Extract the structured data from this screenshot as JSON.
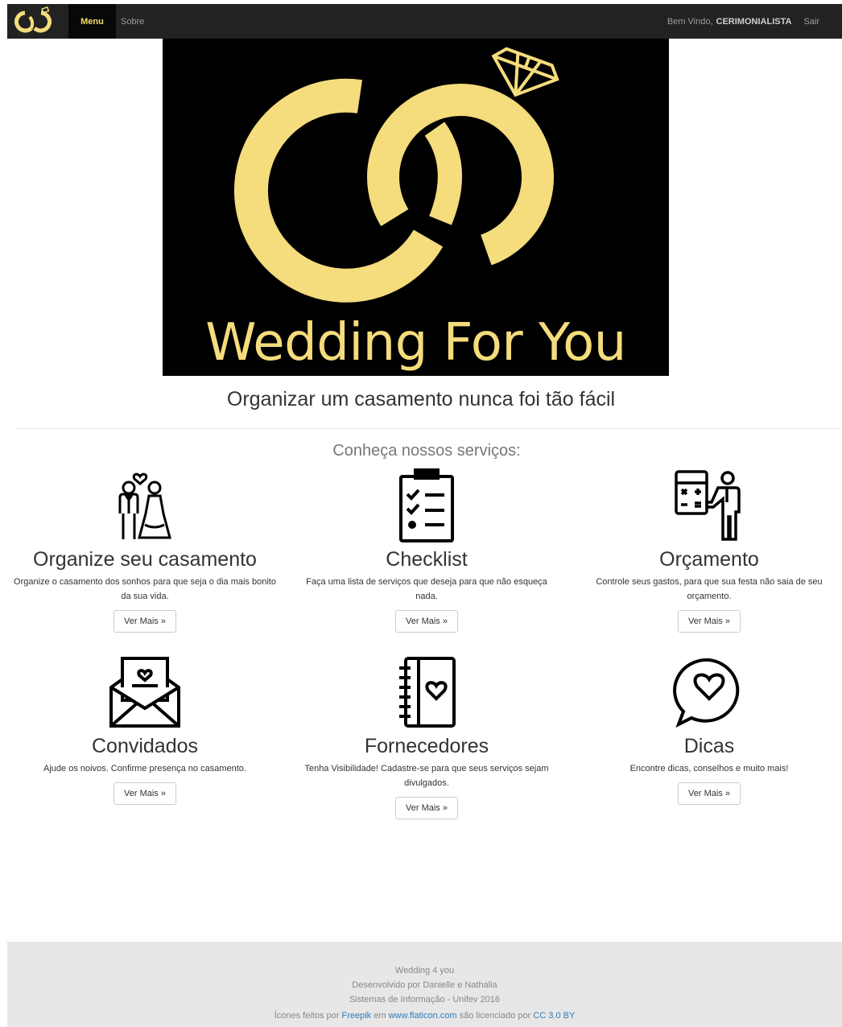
{
  "nav": {
    "menu": "Menu",
    "sobre": "Sobre",
    "welcome": "Bem Vindo,",
    "user": "CERIMONIALISTA",
    "logout": "Sair"
  },
  "hero": {
    "title": "Wedding For You",
    "slide_count": 6,
    "active_slide": 1
  },
  "tagline": "Organizar um casamento nunca foi tão fácil",
  "services_title": "Conheça nossos serviços:",
  "services": [
    {
      "title": "Organize seu casamento",
      "desc": "Organize o casamento dos sonhos para que seja o dia mais bonito da sua vida.",
      "button": "Ver Mais »",
      "icon": "bride-groom-icon"
    },
    {
      "title": "Checklist",
      "desc": "Faça uma lista de serviços que deseja para que não esqueça nada.",
      "button": "Ver Mais »",
      "icon": "checklist-icon"
    },
    {
      "title": "Orçamento",
      "desc": "Controle seus gastos, para que sua festa não saia de seu orçamento.",
      "button": "Ver Mais »",
      "icon": "budget-presenter-icon"
    },
    {
      "title": "Convidados",
      "desc": "Ajude os noivos. Confirme presença no casamento.",
      "button": "Ver Mais »",
      "icon": "invitation-envelope-icon"
    },
    {
      "title": "Fornecedores",
      "desc": "Tenha Visibilidade! Cadastre-se para que seus serviços sejam divulgados.",
      "button": "Ver Mais »",
      "icon": "notebook-heart-icon"
    },
    {
      "title": "Dicas",
      "desc": "Encontre dicas, conselhos e muito mais!",
      "button": "Ver Mais »",
      "icon": "speech-heart-icon"
    }
  ],
  "footer": {
    "line1": "Wedding 4 you",
    "line2": "Desenvolvido por Danielle e Nathalia",
    "line3": "Sistemas de Informação - Unifev 2016",
    "credit_prefix": "Ícones feitos por",
    "credit_author": "Freepik",
    "credit_mid": "em",
    "credit_site": "www.flaticon.com",
    "credit_mid2": "são licenciado por",
    "credit_license": "CC 3.0 BY"
  },
  "colors": {
    "brand_gold": "#f5dc7c",
    "navbar": "#222222",
    "link": "#337ab7"
  }
}
